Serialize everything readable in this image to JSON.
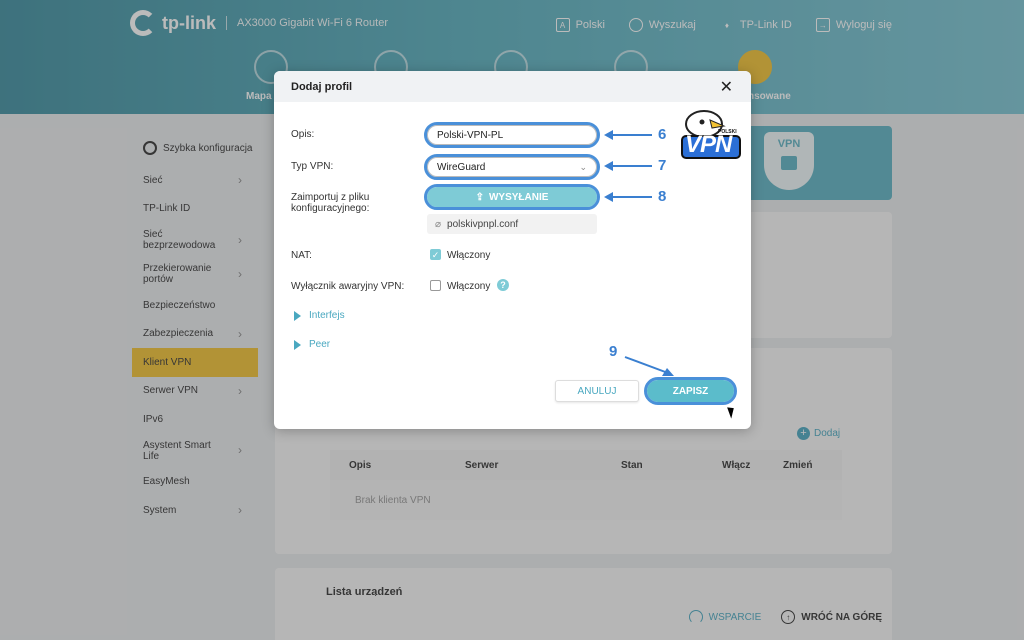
{
  "header": {
    "brand": "tp-link",
    "model": "AX3000 Gigabit Wi-Fi 6 Router",
    "links": [
      {
        "label": "Polski",
        "icon": "language-icon"
      },
      {
        "label": "Wyszukaj",
        "icon": "search-icon"
      },
      {
        "label": "TP-Link ID",
        "icon": "user-id-icon"
      },
      {
        "label": "Wyloguj się",
        "icon": "logout-icon"
      }
    ],
    "nav": {
      "left_label": "Mapa",
      "right_label": "nsowane"
    }
  },
  "sidebar": {
    "quick": "Szybka konfiguracja",
    "items": [
      {
        "label": "Sieć",
        "chevron": true
      },
      {
        "label": "TP-Link ID",
        "chevron": false
      },
      {
        "label": "Sieć bezprzewodowa",
        "chevron": true
      },
      {
        "label": "Przekierowanie portów",
        "chevron": true
      },
      {
        "label": "Bezpieczeństwo",
        "chevron": false
      },
      {
        "label": "Zabezpieczenia",
        "chevron": true
      },
      {
        "label": "Klient VPN",
        "chevron": false,
        "active": true
      },
      {
        "label": "Serwer VPN",
        "chevron": true
      },
      {
        "label": "IPv6",
        "chevron": false
      },
      {
        "label": "Asystent Smart Life",
        "chevron": true
      },
      {
        "label": "EasyMesh",
        "chevron": false
      },
      {
        "label": "System",
        "chevron": true
      }
    ]
  },
  "content": {
    "banner_text": "VPN",
    "add_label": "Dodaj",
    "table": {
      "columns": [
        "Opis",
        "Serwer",
        "Stan",
        "Włącz",
        "Zmień"
      ],
      "empty": "Brak klienta VPN"
    },
    "devices_title": "Lista urządzeń"
  },
  "footer": {
    "support": "WSPARCIE",
    "top": "WRÓĆ NA GÓRĘ"
  },
  "modal": {
    "title": "Dodaj profil",
    "desc_label": "Opis:",
    "desc_value": "Polski-VPN-PL",
    "type_label": "Typ VPN:",
    "type_value": "WireGuard",
    "import_label": "Zaimportuj z pliku konfiguracyjnego:",
    "upload_label": "WYSYŁANIE",
    "file_name": "polskivpnpl.conf",
    "nat_label": "NAT:",
    "nat_checked": true,
    "nat_text": "Włączony",
    "kill_label": "Wyłącznik awaryjny VPN:",
    "kill_checked": false,
    "kill_text": "Włączony",
    "acc_interface": "Interfejs",
    "acc_peer": "Peer",
    "cancel": "ANULUJ",
    "save": "ZAPISZ"
  },
  "annotations": [
    "6",
    "7",
    "8",
    "9"
  ],
  "watermark": {
    "top": "POLSKI",
    "bottom": "VPN"
  },
  "colors": {
    "accent": "#4aa8c0",
    "active": "#f2c233",
    "arrow": "#3a7fd0"
  }
}
